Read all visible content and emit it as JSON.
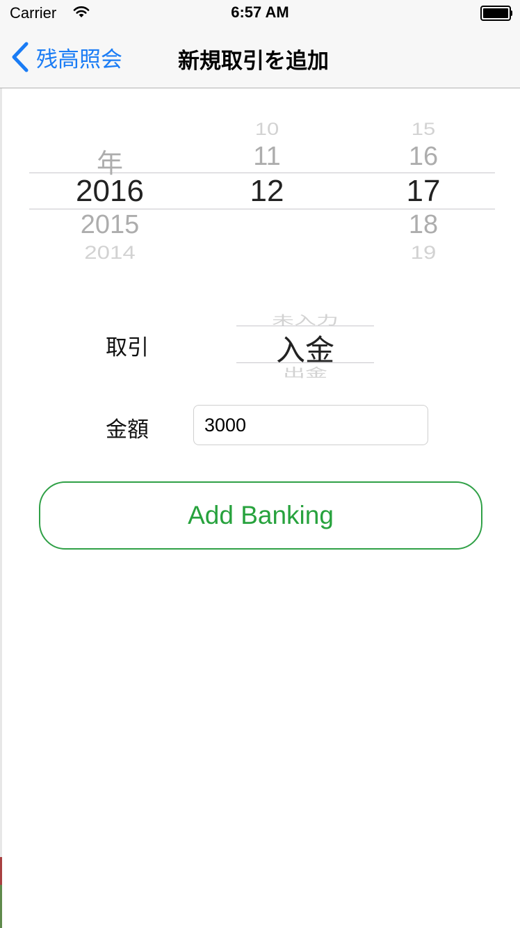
{
  "status_bar": {
    "carrier": "Carrier",
    "time": "6:57 AM",
    "battery_level": 1.0
  },
  "nav": {
    "back_label": "残高照会",
    "title": "新規取引を追加"
  },
  "date_picker": {
    "year": {
      "above": "年",
      "selected": "2016",
      "below": [
        "2015",
        "2014"
      ]
    },
    "month": {
      "above": [
        "10",
        "11"
      ],
      "selected": "12"
    },
    "day": {
      "above": [
        "15",
        "16"
      ],
      "selected": "17",
      "below": [
        "18",
        "19"
      ]
    }
  },
  "transaction": {
    "label": "取引",
    "above": "未入力",
    "selected": "入金",
    "below": "出金"
  },
  "amount": {
    "label": "金額",
    "value": "3000"
  },
  "add_button_label": "Add Banking",
  "colors": {
    "accent_blue": "#1a7cf5",
    "button_green": "#27a23d"
  },
  "icons": [
    "wifi-icon",
    "battery-icon",
    "back-chevron-icon"
  ]
}
